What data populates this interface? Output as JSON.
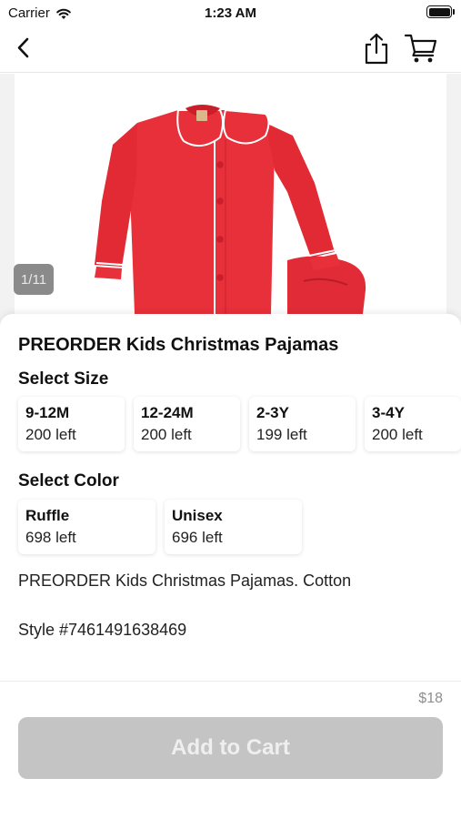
{
  "status_bar": {
    "carrier": "Carrier",
    "time": "1:23 AM"
  },
  "nav": {
    "back_icon": "chevron-left-icon",
    "share_icon": "share-icon",
    "cart_icon": "cart-icon"
  },
  "gallery": {
    "counter": "1/11",
    "product_color": "#e8303a"
  },
  "product": {
    "title": "PREORDER Kids Christmas Pajamas",
    "size_label": "Select Size",
    "sizes": [
      {
        "name": "9-12M",
        "left": "200 left"
      },
      {
        "name": "12-24M",
        "left": "200 left"
      },
      {
        "name": "2-3Y",
        "left": "199 left"
      },
      {
        "name": "3-4Y",
        "left": "200 left"
      }
    ],
    "color_label": "Select Color",
    "colors": [
      {
        "name": "Ruffle",
        "left": "698 left"
      },
      {
        "name": "Unisex",
        "left": "696 left"
      }
    ],
    "description": "PREORDER Kids Christmas Pajamas. Cotton",
    "style": "Style #7461491638469"
  },
  "footer": {
    "price": "$18",
    "add_to_cart": "Add to Cart",
    "button_color": "#c4c4c4"
  }
}
